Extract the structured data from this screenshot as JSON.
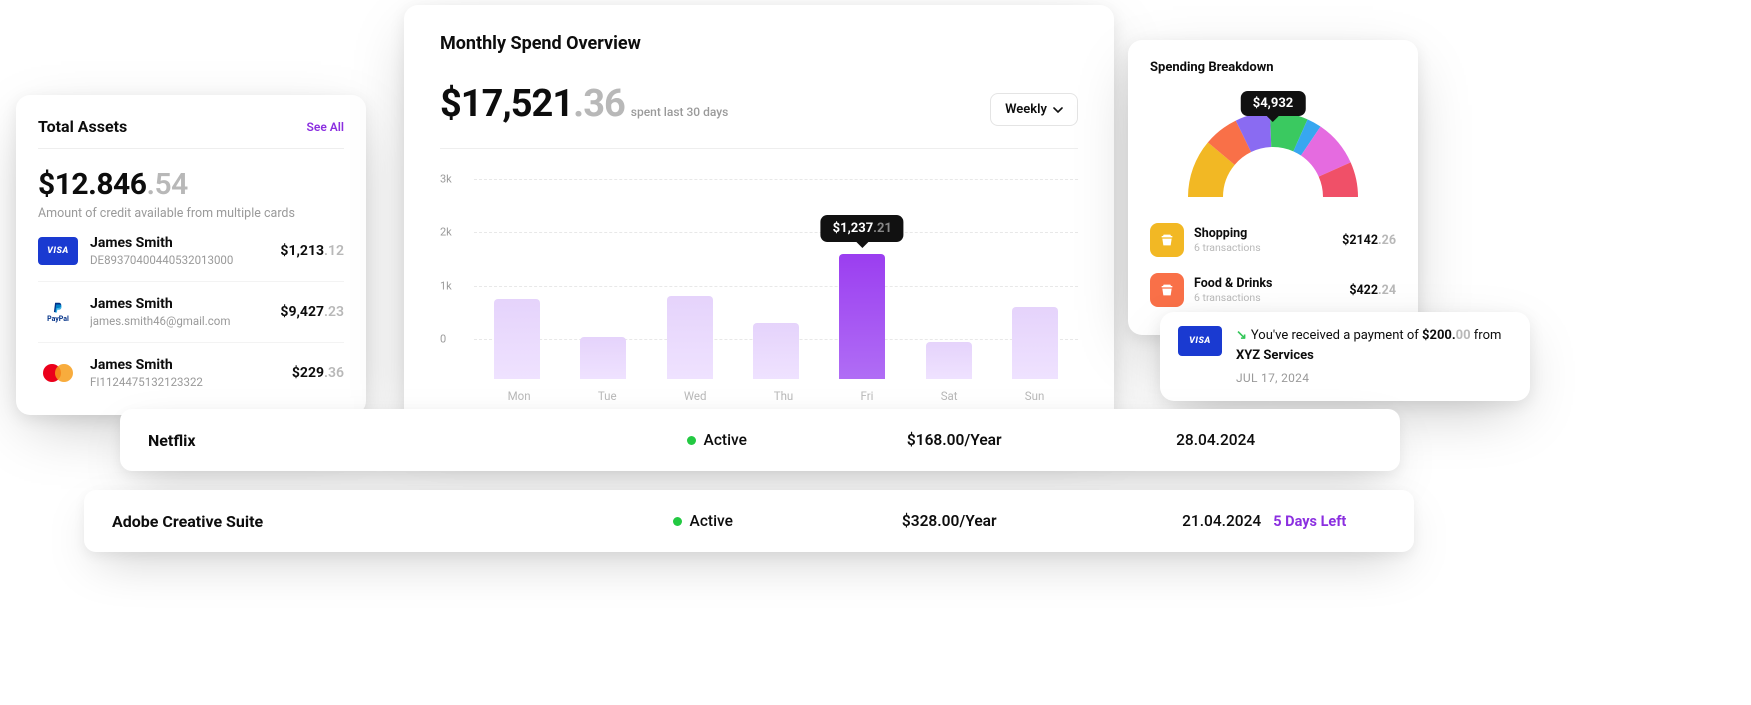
{
  "assets": {
    "title": "Total Assets",
    "see_all": "See All",
    "total_main": "$12.846",
    "total_dec": ".54",
    "subtitle": "Amount of credit available from multiple cards",
    "accounts": [
      {
        "brand": "visa",
        "brand_label": "VISA",
        "name": "James Smith",
        "sub": "DE89370400440532013000",
        "amt_main": "$1,213",
        "amt_dec": ".12"
      },
      {
        "brand": "paypal",
        "brand_label": "PayPal",
        "name": "James Smith",
        "sub": "james.smith46@gmail.com",
        "amt_main": "$9,427",
        "amt_dec": ".23"
      },
      {
        "brand": "mc",
        "brand_label": "",
        "name": "James Smith",
        "sub": "FI1124475132123322",
        "amt_main": "$229",
        "amt_dec": ".36"
      }
    ]
  },
  "spend": {
    "title": "Monthly Spend Overview",
    "amount_main": "$17,521",
    "amount_dec": ".36",
    "amount_note": "spent last 30 days",
    "dropdown": "Weekly",
    "tooltip_main": "$1,237",
    "tooltip_dec": ".21"
  },
  "chart_data": {
    "type": "bar",
    "categories": [
      "Mon",
      "Tue",
      "Wed",
      "Thu",
      "Fri",
      "Sat",
      "Sun"
    ],
    "values": [
      1500,
      780,
      1550,
      1050,
      2350,
      700,
      1350
    ],
    "highlight_index": 4,
    "highlight_tooltip": "$1,237.21",
    "ylabel_ticks": [
      "3k",
      "2k",
      "1k",
      "0"
    ],
    "ylim": [
      0,
      3000
    ],
    "title": "Monthly Spend Overview"
  },
  "breakdown": {
    "title": "Spending Breakdown",
    "gauge_tip": "$4,932",
    "arcs": [
      {
        "color": "#f2b824",
        "start": 180,
        "end": 220
      },
      {
        "color": "#f97048",
        "start": 220,
        "end": 244
      },
      {
        "color": "#8a6bf2",
        "start": 244,
        "end": 268
      },
      {
        "color": "#3ac960",
        "start": 268,
        "end": 294
      },
      {
        "color": "#37a7f0",
        "start": 294,
        "end": 304
      },
      {
        "color": "#e56be0",
        "start": 304,
        "end": 336
      },
      {
        "color": "#f05068",
        "start": 336,
        "end": 360
      }
    ],
    "cats": [
      {
        "color": "#f2b824",
        "name": "Shopping",
        "sub": "6 transactions",
        "amt_main": "$2142",
        "amt_dec": ".26"
      },
      {
        "color": "#f97048",
        "name": "Food & Drinks",
        "sub": "6 transactions",
        "amt_main": "$422",
        "amt_dec": ".24"
      }
    ]
  },
  "notif": {
    "text_pre": "You've received a payment of ",
    "amount_main": "$200.",
    "amount_dec": "00",
    "text_mid": " from ",
    "from": "XYZ Services",
    "date": "JUL 17, 2024"
  },
  "subs": [
    {
      "name": "Netflix",
      "status": "Active",
      "price": "$168.00/Year",
      "date": "28.04.2024",
      "days_left": ""
    },
    {
      "name": "Adobe Creative Suite",
      "status": "Active",
      "price": "$328.00/Year",
      "date": "21.04.2024",
      "days_left": "5 Days Left"
    }
  ]
}
